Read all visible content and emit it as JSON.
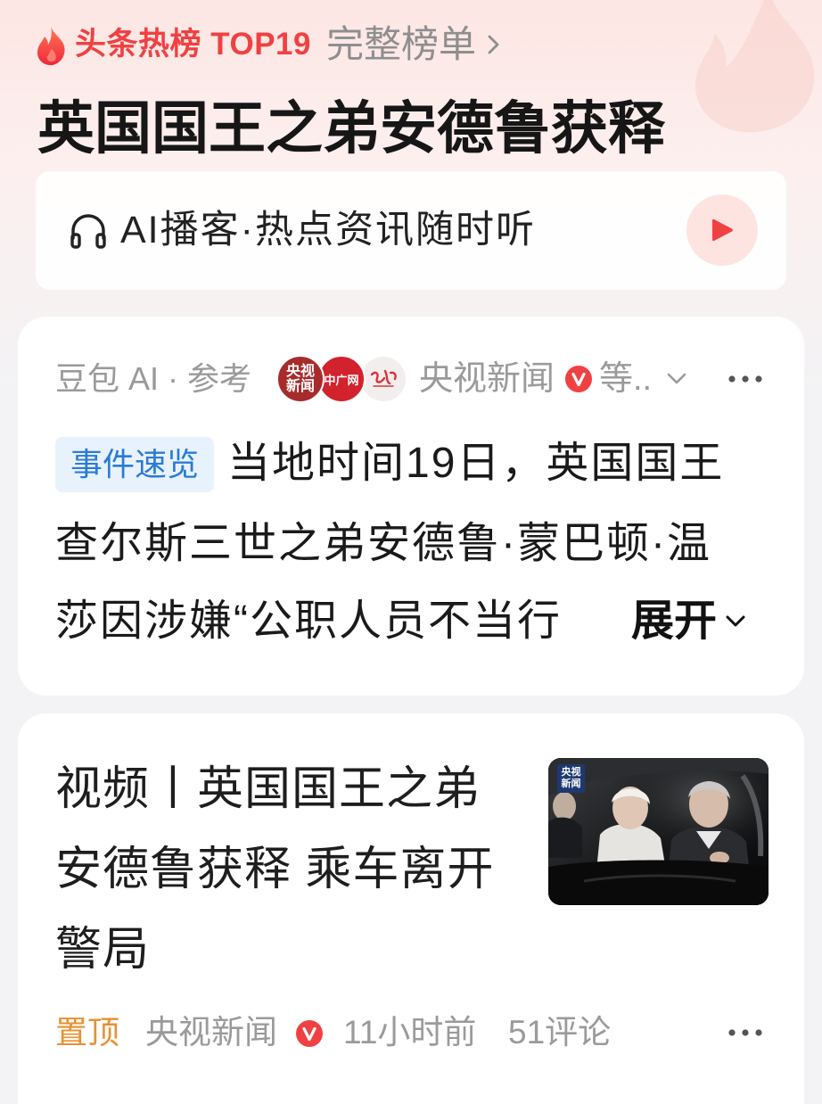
{
  "header": {
    "brand_icon": "flame-icon",
    "brand": "头条热榜 TOP19",
    "full_list_label": "完整榜单",
    "full_list_icon": "chevron-right-icon"
  },
  "title": "英国国王之弟安德鲁获释",
  "podcast": {
    "icon": "headphones-icon",
    "label": "AI播客·热点资讯随时听",
    "play_icon": "play-icon"
  },
  "summary_card": {
    "source_prefix": "豆包 AI · 参考",
    "source_logos": [
      {
        "icon": "cctv-news-logo",
        "text_lines": [
          "央视",
          "新闻"
        ],
        "color": "#a62c2c"
      },
      {
        "icon": "cnr-logo",
        "text_lines": [
          "中广网"
        ],
        "color": "#d2222d"
      },
      {
        "icon": "calligraphy-logo",
        "color": "#f3eeee"
      }
    ],
    "source_name": "央视新闻",
    "verified_icon": "verified-v-icon",
    "more_sources": "等..",
    "more_sources_icon": "chevron-down-icon",
    "menu_icon": "more-dots-icon",
    "tag": "事件速览",
    "summary_lines": [
      "当地时间19日，英国国王",
      "查尔斯三世之弟安德鲁·蒙巴顿·温",
      "莎因涉嫌“公职人员不当行"
    ],
    "expand_label": "展开",
    "expand_icon": "chevron-down-icon"
  },
  "video_card": {
    "title_lines": [
      "视频丨英国国王之弟",
      "安德鲁获释 乘车离开",
      "警局"
    ],
    "thumbnail_badge": [
      "央视",
      "新闻"
    ],
    "pinned_label": "置顶",
    "source_name": "央视新闻",
    "verified_icon": "verified-v-icon",
    "time": "11小时前",
    "comments": "51评论",
    "menu_icon": "more-dots-icon"
  },
  "colors": {
    "brand_red": "#f04142",
    "tag_bg": "#e8f2fd",
    "tag_text": "#2a7bd6",
    "pinned_orange": "#e9902f",
    "meta_gray": "#9a9a9a",
    "text_dark": "#1e1e1e",
    "play_bg": "#fde4e1"
  }
}
